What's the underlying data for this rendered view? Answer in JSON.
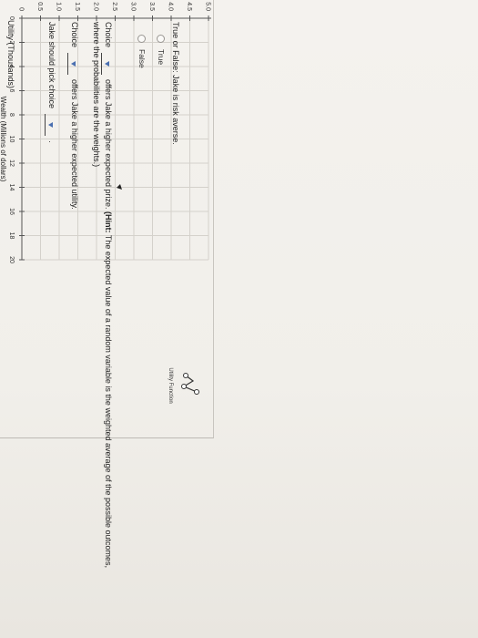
{
  "chart": {
    "y_axis_title": "Utility (Thousands)",
    "x_axis_title": "Wealth (Millions of dollars)",
    "y_ticks": [
      "0",
      "0.5",
      "1.0",
      "1.5",
      "2.0",
      "2.5",
      "3.0",
      "3.5",
      "4.0",
      "4.5",
      "5.0"
    ],
    "x_ticks": [
      "0",
      "2",
      "4",
      "6",
      "8",
      "10",
      "12",
      "14",
      "16",
      "18",
      "20"
    ],
    "legend_label": "Utility Function",
    "legend_icon": "polyline-tool-icon"
  },
  "chart_data": {
    "type": "line",
    "title": "",
    "xlabel": "Wealth (Millions of dollars)",
    "ylabel": "Utility (Thousands)",
    "xlim": [
      0,
      20
    ],
    "ylim": [
      0,
      5.0
    ],
    "grid": true,
    "series": []
  },
  "question1": {
    "prompt": "True or False: Jake is risk averse.",
    "options": [
      "True",
      "False"
    ]
  },
  "question2": {
    "choice_word": "Choice",
    "sentence_part1": "offers Jake a higher expected prize.",
    "hint_label": "(Hint:",
    "hint_text": "The expected value of a random variable is the weighted average of the possible outcomes,",
    "hint_line2": "where the probabilities are the weights.)"
  },
  "question3": {
    "choice_word": "Choice",
    "sentence": "offers Jake a higher expected utility."
  },
  "question4": {
    "sentence": "Jake should pick choice",
    "period": "."
  }
}
